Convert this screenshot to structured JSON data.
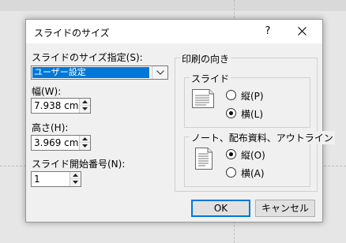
{
  "dialog": {
    "title": "スライドのサイズ",
    "help_label": "?",
    "slide_size": {
      "label": "スライドのサイズ指定(S):",
      "value": "ユーザー設定"
    },
    "width": {
      "label": "幅(W):",
      "value": "7.938 cm"
    },
    "height": {
      "label": "高さ(H):",
      "value": "3.969 cm"
    },
    "start_number": {
      "label": "スライド開始番号(N):",
      "value": "1"
    },
    "orientation": {
      "title": "印刷の向き",
      "slides": {
        "title": "スライド",
        "portrait_label": "縦(P)",
        "landscape_label": "横(L)",
        "selected": "landscape"
      },
      "notes": {
        "title": "ノート、配布資料、アウトライン",
        "portrait_label": "縦(O)",
        "landscape_label": "横(A)",
        "selected": "portrait"
      }
    },
    "buttons": {
      "ok": "OK",
      "cancel": "キャンセル"
    }
  },
  "colors": {
    "selection": "#0078d7",
    "dialog_bg": "#f0f0f0",
    "titlebar_bg": "#ffffff"
  }
}
